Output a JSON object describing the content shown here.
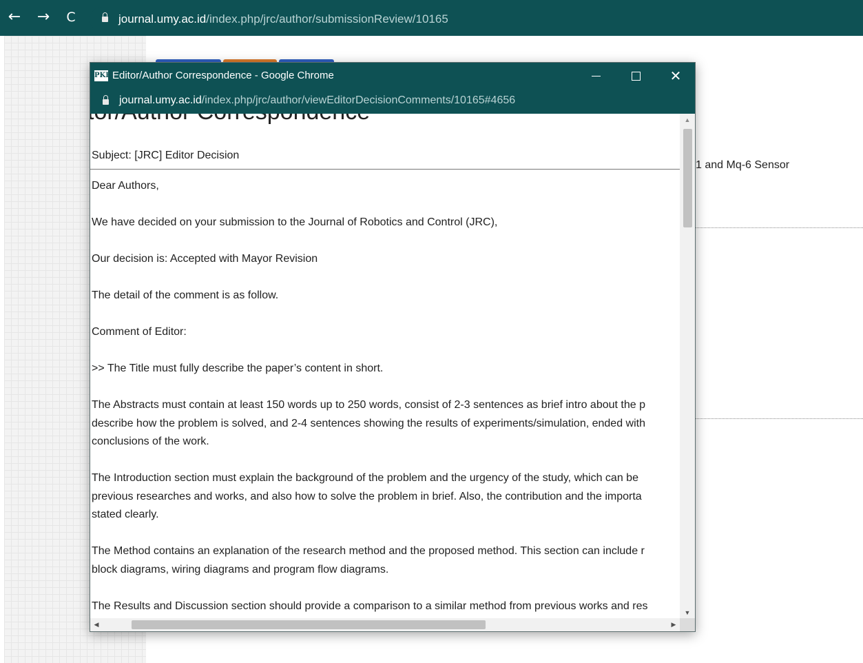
{
  "browser": {
    "url_host": "journal.umy.ac.id",
    "url_path": "/index.php/jrc/author/submissionReview/10165"
  },
  "background_page": {
    "visible_title_fragment": "1 and Mq-6 Sensor",
    "tab_colors": [
      "#2f5fc1",
      "#d9792b",
      "#2f5fc1"
    ]
  },
  "popup": {
    "favicon_text": "PKP",
    "title": "Editor/Author Correspondence - Google Chrome",
    "url_host": "journal.umy.ac.id",
    "url_path": "/index.php/jrc/author/viewEditorDecisionComments/10165#4656",
    "page_heading": "tor/Author Correspondence",
    "subject": "Subject: [JRC] Editor Decision",
    "paragraphs": [
      [
        "Dear Authors,"
      ],
      [
        "We have decided on your submission to the Journal of Robotics and Control (JRC),"
      ],
      [
        "Our decision is: Accepted with Mayor Revision"
      ],
      [
        "The detail of the comment is as follow."
      ],
      [
        "Comment of Editor:"
      ],
      [
        ">> The Title must fully describe the paper’s content in short."
      ],
      [
        "The Abstracts must contain at least 150 words up to 250 words, consist of 2-3 sentences as brief intro about the p",
        "describe how the problem is solved, and 2-4 sentences showing the results of experiments/simulation, ended with",
        "conclusions of the work."
      ],
      [
        "The Introduction section must explain the background of the problem and the urgency of the study, which can be",
        "previous researches and works, and also how to solve the problem in brief. Also, the contribution and the importa",
        "stated clearly."
      ],
      [
        "The Method contains an explanation of the research method and the proposed method. This section can include r",
        "block diagrams, wiring diagrams and program flow diagrams."
      ],
      [
        "The Results and Discussion section should provide a comparison to a similar method from previous works and res"
      ]
    ]
  },
  "colors": {
    "chrome_bar": "#0e5154",
    "text": "#222222"
  }
}
